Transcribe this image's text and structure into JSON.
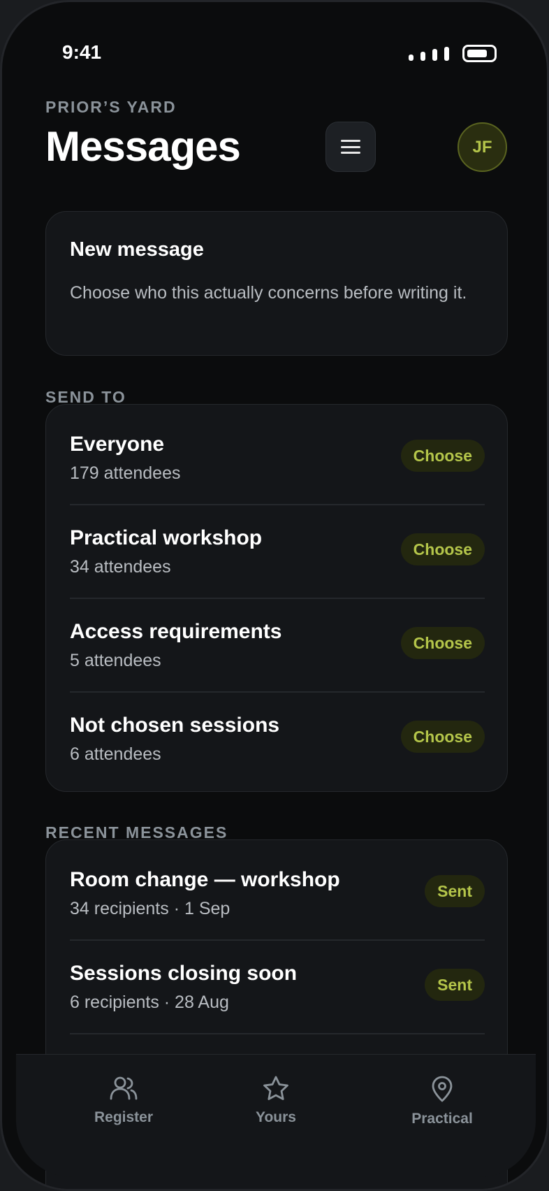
{
  "status_bar": {
    "time": "9:41"
  },
  "header": {
    "eyebrow": "PRIOR’S YARD",
    "title": "Messages",
    "avatar_initials": "JF"
  },
  "new_message": {
    "title": "New message",
    "description": "Choose who this actually concerns before writing it."
  },
  "send_to": {
    "label": "SEND TO",
    "items": [
      {
        "title": "Everyone",
        "subtitle": "179 attendees",
        "action": "Choose"
      },
      {
        "title": "Practical workshop",
        "subtitle": "34 attendees",
        "action": "Choose"
      },
      {
        "title": "Access requirements",
        "subtitle": "5 attendees",
        "action": "Choose"
      },
      {
        "title": "Not chosen sessions",
        "subtitle": "6 attendees",
        "action": "Choose"
      }
    ]
  },
  "recent": {
    "label": "RECENT MESSAGES",
    "items": [
      {
        "title": "Room change — workshop",
        "subtitle": "34 recipients · 1 Sep",
        "status": "Sent"
      },
      {
        "title": "Sessions closing soon",
        "subtitle": "6 recipients · 28 Aug",
        "status": "Sent"
      }
    ]
  },
  "tabs": [
    {
      "label": "Register",
      "icon": "users-icon"
    },
    {
      "label": "Yours",
      "icon": "star-icon"
    },
    {
      "label": "Practical",
      "icon": "map-pin-icon"
    }
  ],
  "colors": {
    "accent": "#b4c54a",
    "background": "#0b0c0d",
    "card": "#141619"
  }
}
